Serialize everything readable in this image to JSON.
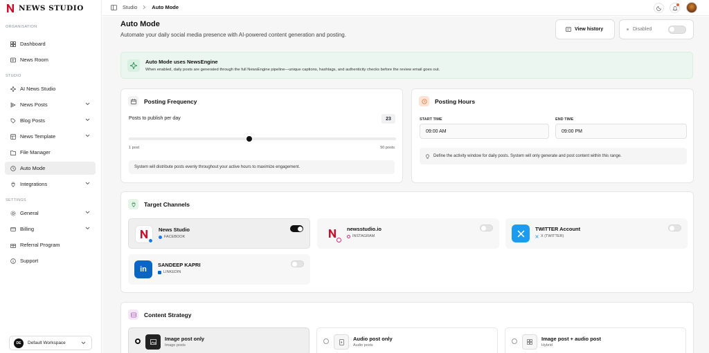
{
  "brand": {
    "name": "NEWS STUDIO"
  },
  "sidebar": {
    "sections": [
      {
        "label": "ORGANISATION"
      },
      {
        "label": "STUDIO"
      },
      {
        "label": "SETTINGS"
      }
    ],
    "items": [
      {
        "label": "Dashboard",
        "icon": "dashboard-icon"
      },
      {
        "label": "News Room",
        "icon": "newspaper-icon"
      },
      {
        "label": "AI News Studio",
        "icon": "sparkle-icon"
      },
      {
        "label": "News Posts",
        "icon": "send-icon"
      },
      {
        "label": "Blog Posts",
        "icon": "tag-icon"
      },
      {
        "label": "News Template",
        "icon": "template-icon"
      },
      {
        "label": "File Manager",
        "icon": "folder-icon"
      },
      {
        "label": "Auto Mode",
        "icon": "clock-icon",
        "active": true
      },
      {
        "label": "Integrations",
        "icon": "plug-icon"
      },
      {
        "label": "General",
        "icon": "gear-icon"
      },
      {
        "label": "Billing",
        "icon": "card-icon"
      },
      {
        "label": "Referral Program",
        "icon": "gift-icon"
      },
      {
        "label": "Support",
        "icon": "info-icon"
      }
    ],
    "workspace": {
      "initials": "DE",
      "name": "Default Workspace"
    }
  },
  "topbar": {
    "breadcrumb": [
      "Studio",
      "Auto Mode"
    ]
  },
  "page": {
    "title": "Auto Mode",
    "subtitle": "Automate your daily social media presence with AI-powered content generation and posting.",
    "view_history": "View history",
    "status_label": "Disabled"
  },
  "banner": {
    "title": "Auto Mode uses NewsEngine",
    "desc": "When enabled, daily posts are generated through the full NewsEngine pipeline—unique captions, hashtags, and authenticity checks before the review email goes out."
  },
  "frequency": {
    "title": "Posting Frequency",
    "label": "Posts to publish per day",
    "value": "23",
    "min_label": "1 post",
    "max_label": "50 posts",
    "slider_fraction": 0.45,
    "note": "System will distribute posts evenly throughout your active hours to maximize engagement."
  },
  "hours": {
    "title": "Posting Hours",
    "start_label": "START TIME",
    "start_value": "09:00 AM",
    "end_label": "END TIME",
    "end_value": "09:00 PM",
    "note": "Define the activity window for daily posts. System will only generate and post content within this range."
  },
  "channels": {
    "title": "Target Channels",
    "items": [
      {
        "name": "News Studio",
        "platform": "FACEBOOK",
        "enabled": true
      },
      {
        "name": "newsstudio.io",
        "platform": "INSTAGRAM",
        "enabled": false
      },
      {
        "name": "TWITTER Account",
        "platform": "X (TWITTER)",
        "enabled": false
      },
      {
        "name": "SANDEEP KAPRI",
        "platform": "LINKEDIN",
        "enabled": false
      }
    ]
  },
  "strategy": {
    "title": "Content Strategy",
    "options": [
      {
        "name": "Image post only",
        "desc": "Image posts",
        "selected": true
      },
      {
        "name": "Audio post only",
        "desc": "Audio posts",
        "selected": false
      },
      {
        "name": "Image post + audio post",
        "desc": "Hybrid",
        "selected": false
      }
    ]
  },
  "colors": {
    "accent": "#111111",
    "banner_bg": "#eaf6ef",
    "brand_red": "#c8102e"
  }
}
